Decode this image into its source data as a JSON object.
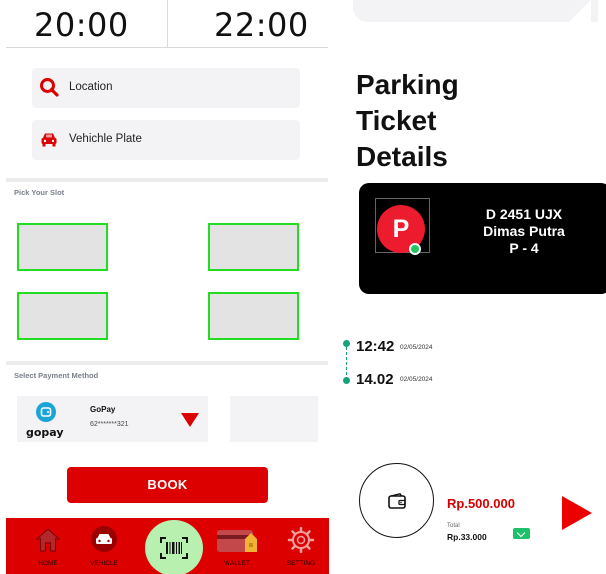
{
  "booking": {
    "time_start": "20:00",
    "time_end": "22:00",
    "location_label": "Location",
    "plate_label": "Vehichle Plate",
    "slot_section_label": "Pick Your Slot",
    "slots": [
      "slot-1",
      "slot-2",
      "slot-3",
      "slot-4"
    ],
    "payment_section_label": "Select Payment Method",
    "payment": {
      "brand": "gopay",
      "name": "GoPay",
      "number": "62*******321"
    },
    "book_label": "BOOK"
  },
  "nav": {
    "items": [
      {
        "label": "HOME",
        "icon": "home-icon"
      },
      {
        "label": "VEHICLE",
        "icon": "car-icon"
      },
      {
        "label": "",
        "icon": "barcode-scan-icon"
      },
      {
        "label": "WALLET",
        "icon": "wallet-icon"
      },
      {
        "label": "SETTING",
        "icon": "gear-icon"
      }
    ]
  },
  "ticket": {
    "title_line1": "Parking",
    "title_line2": "Ticket",
    "title_line3": "Details",
    "logo_letter": "P",
    "plate": "D 2451 UJX",
    "owner": "Dimas Putra",
    "slot": "P - 4",
    "entry_time": "12:42",
    "entry_date": "02/05/2024",
    "exit_time": "14.02",
    "exit_date": "02/05/2024",
    "amount": "Rp.500.000",
    "total_label": "Total",
    "total_value": "Rp.33.000"
  },
  "colors": {
    "brand_red": "#dd0000",
    "slot_border": "#22dd22",
    "scan_button": "#b8f0b0",
    "timeline": "#14a37a"
  }
}
